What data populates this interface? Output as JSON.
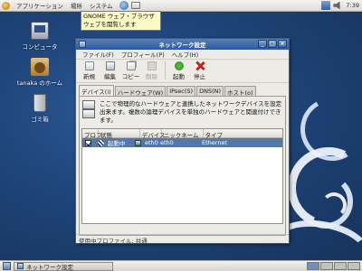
{
  "top_panel": {
    "menus": [
      "アプリケーション",
      "場所",
      "システム"
    ],
    "clock": "7:39"
  },
  "tooltip": "GNOME ウェブ・ブラウザ\nウェブを閲覧します",
  "desktop_icons": [
    {
      "label": "コンピュータ",
      "icon": "computer-icon"
    },
    {
      "label": "tanaka のホーム",
      "icon": "home-folder-icon"
    },
    {
      "label": "ゴミ箱",
      "icon": "trash-icon"
    }
  ],
  "window": {
    "title": "ネットワーク設定",
    "menubar": [
      "ファイル(F)",
      "プロフィール(P)",
      "ヘルプ(H)"
    ],
    "toolbar": [
      {
        "label": "新規",
        "icon": "new-icon",
        "enabled": true
      },
      {
        "label": "編集",
        "icon": "edit-icon",
        "enabled": true
      },
      {
        "label": "コピー",
        "icon": "copy-icon",
        "enabled": true
      },
      {
        "label": "削除",
        "icon": "delete-icon",
        "enabled": false
      },
      {
        "label": "起動",
        "icon": "activate-icon",
        "enabled": true
      },
      {
        "label": "停止",
        "icon": "deactivate-icon",
        "enabled": true
      }
    ],
    "tabs": [
      "デバイス(i)",
      "ハードウェア(W)",
      "IPsec(S)",
      "DNS(N)",
      "ホスト(o)"
    ],
    "active_tab": 0,
    "description": "ここで物理的なハードウェアと連携したネットワークデバイスを設定出来ます。複数の論理デバイスを単独のハードウェアと関連付けできます。",
    "table": {
      "headers": [
        "プロフ",
        "状態",
        "デバイス",
        "ニックネーム",
        "タイプ"
      ],
      "rows": [
        {
          "profile_checked": true,
          "status": "起動中",
          "device": "eth0",
          "nickname": "eth0",
          "type": "Ethernet"
        }
      ]
    },
    "statusbar": "使用中プロファイル: 共通"
  },
  "bottom_panel": {
    "task": "ネットワーク設定"
  }
}
